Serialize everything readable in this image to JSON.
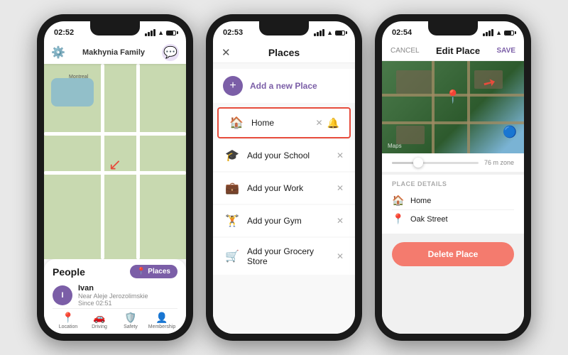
{
  "phone1": {
    "status_time": "02:52",
    "header_title": "Makhynia Family",
    "map_label": "Montreal",
    "people_title": "People",
    "places_btn": "Places",
    "person_name": "Ivan",
    "person_location": "Near Aleje Jerozolimskie",
    "person_since": "Since 02:51",
    "person_initial": "I",
    "tabs": [
      "Location",
      "Driving",
      "Safety",
      "Membership"
    ],
    "tab_icons": [
      "📍",
      "🚗",
      "🛡️",
      "👤"
    ]
  },
  "phone2": {
    "status_time": "02:53",
    "title": "Places",
    "add_new_label": "Add a new Place",
    "items": [
      {
        "name": "Home",
        "icon": "🏠",
        "highlighted": true
      },
      {
        "name": "Add your School",
        "icon": "🎓",
        "highlighted": false
      },
      {
        "name": "Add your Work",
        "icon": "💼",
        "highlighted": false
      },
      {
        "name": "Add your Gym",
        "icon": "🏋️",
        "highlighted": false
      },
      {
        "name": "Add your Grocery Store",
        "icon": "🛒",
        "highlighted": false
      }
    ]
  },
  "phone3": {
    "status_time": "02:54",
    "cancel_label": "CANCEL",
    "title": "Edit Place",
    "save_label": "SAVE",
    "zone_label": "76 m zone",
    "maps_label": "Maps",
    "place_details_title": "Place details",
    "place_name": "Home",
    "place_address": "Oak Street",
    "delete_btn": "Delete Place"
  }
}
